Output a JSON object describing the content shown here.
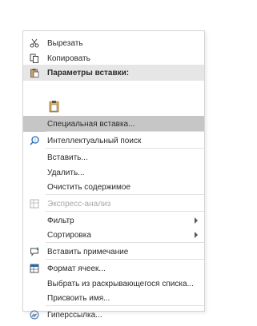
{
  "menu": {
    "items": [
      {
        "label": "Вырезать",
        "icon": "scissors-icon"
      },
      {
        "label": "Копировать",
        "icon": "copy-icon"
      },
      {
        "label": "Параметры вставки:",
        "icon": "paste-icon"
      },
      {
        "label": "Специальная вставка...",
        "icon": ""
      },
      {
        "label": "Интеллектуальный поиск",
        "icon": "smart-lookup-icon"
      },
      {
        "label": "Вставить...",
        "icon": ""
      },
      {
        "label": "Удалить...",
        "icon": ""
      },
      {
        "label": "Очистить содержимое",
        "icon": ""
      },
      {
        "label": "Экспресс-анализ",
        "icon": "quick-analysis-icon"
      },
      {
        "label": "Фильтр",
        "icon": ""
      },
      {
        "label": "Сортировка",
        "icon": ""
      },
      {
        "label": "Вставить примечание",
        "icon": "comment-icon"
      },
      {
        "label": "Формат ячеек...",
        "icon": "format-cells-icon"
      },
      {
        "label": "Выбрать из раскрывающегося списка...",
        "icon": ""
      },
      {
        "label": "Присвоить имя...",
        "icon": ""
      },
      {
        "label": "Гиперссылка...",
        "icon": "hyperlink-icon"
      }
    ]
  },
  "colors": {
    "header_bg": "#e6e6e6",
    "selected_bg": "#c6c6c6",
    "disabled_text": "#a6a6a6"
  }
}
